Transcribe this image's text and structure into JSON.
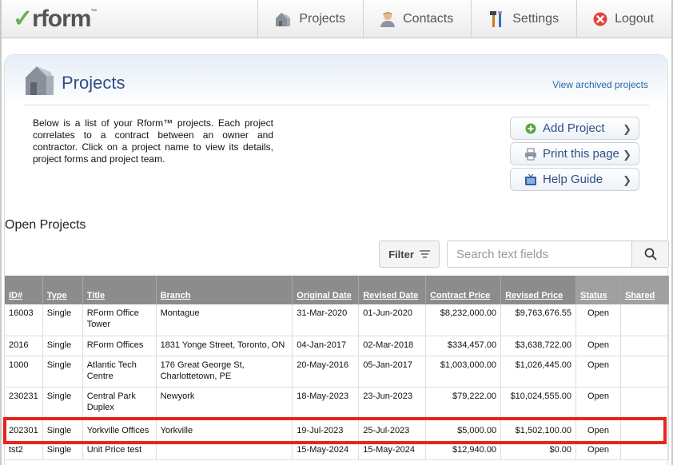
{
  "brand": {
    "check": "✓",
    "name": "rform",
    "tm": "™"
  },
  "nav": [
    {
      "label": "Projects",
      "icon": "house-icon"
    },
    {
      "label": "Contacts",
      "icon": "person-icon"
    },
    {
      "label": "Settings",
      "icon": "tools-icon"
    },
    {
      "label": "Logout",
      "icon": "close-circle-icon"
    }
  ],
  "page": {
    "title": "Projects",
    "archived_link": "View archived projects",
    "intro": "Below is a list of your Rform™ projects. Each project correlates to a contract between an owner and contractor. Click on a project name to view its details, project forms and project team."
  },
  "actions": {
    "add": "Add Project",
    "print": "Print this page",
    "help": "Help Guide"
  },
  "section_title": "Open Projects",
  "filter": {
    "label": "Filter"
  },
  "search": {
    "placeholder": "Search text fields"
  },
  "table": {
    "headers": [
      "ID#",
      "Type",
      "Title",
      "Branch",
      "Original Date",
      "Revised Date",
      "Contract Price",
      "Revised Price",
      "Status",
      "Shared"
    ],
    "rows": [
      {
        "id": "16003",
        "type": "Single",
        "title": "RForm Office Tower",
        "branch": "Montague",
        "original_date": "31-Mar-2020",
        "revised_date": "01-Jun-2020",
        "contract_price": "$8,232,000.00",
        "revised_price": "$9,763,676.55",
        "status": "Open",
        "shared": ""
      },
      {
        "id": "2016",
        "type": "Single",
        "title": "RForm Offices",
        "branch": "1831 Yonge Street, Toronto, ON",
        "original_date": "04-Jan-2017",
        "revised_date": "02-Mar-2018",
        "contract_price": "$334,457.00",
        "revised_price": "$3,638,722.00",
        "status": "Open",
        "shared": ""
      },
      {
        "id": "1000",
        "type": "Single",
        "title": "Atlantic Tech Centre",
        "branch": "176 Great George St, Charlottetown, PE",
        "original_date": "20-May-2016",
        "revised_date": "05-Jan-2017",
        "contract_price": "$1,003,000.00",
        "revised_price": "$1,026,445.00",
        "status": "Open",
        "shared": ""
      },
      {
        "id": "230231",
        "type": "Single",
        "title": "Central Park Duplex",
        "branch": "Newyork",
        "original_date": "18-May-2023",
        "revised_date": "23-Jun-2023",
        "contract_price": "$79,222.00",
        "revised_price": "$10,024,555.00",
        "status": "Open",
        "shared": ""
      },
      {
        "id": "202301",
        "type": "Single",
        "title": "Yorkville Offices",
        "branch": "Yorkville",
        "original_date": "19-Jul-2023",
        "revised_date": "25-Jul-2023",
        "contract_price": "$5,000.00",
        "revised_price": "$1,502,100.00",
        "status": "Open",
        "shared": ""
      },
      {
        "id": "tst2",
        "type": "Single",
        "title": "Unit Price test",
        "branch": "",
        "original_date": "15-May-2024",
        "revised_date": "15-May-2024",
        "contract_price": "$12,940.00",
        "revised_price": "$0.00",
        "status": "Open",
        "shared": ""
      }
    ]
  },
  "colors": {
    "accent": "#2f4f87",
    "link": "#2a65a5",
    "highlight": "#e8251c",
    "header_bg": "#8c8c8c"
  }
}
